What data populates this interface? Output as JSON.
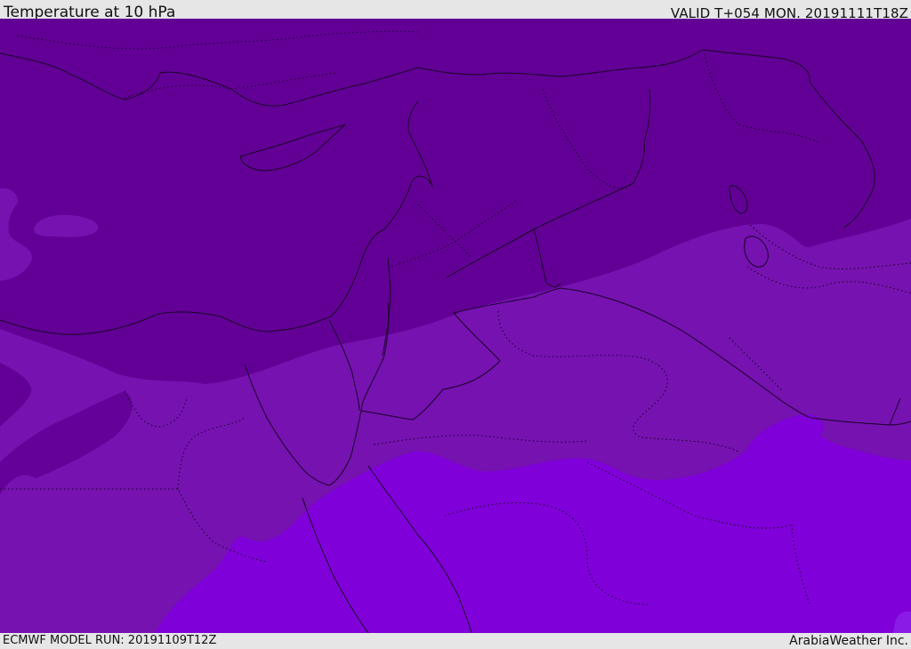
{
  "header": {
    "title": "Temperature at 10 hPa",
    "valid": "VALID T+054 MON. 20191111T18Z"
  },
  "footer": {
    "run": "ECMWF MODEL RUN: 20191109T12Z",
    "credit": "ArabiaWeather Inc."
  },
  "map": {
    "colors": {
      "coldest": "#620096",
      "cold": "#7512b0",
      "mild": "#7f00d9",
      "border": "#1a0026"
    }
  }
}
